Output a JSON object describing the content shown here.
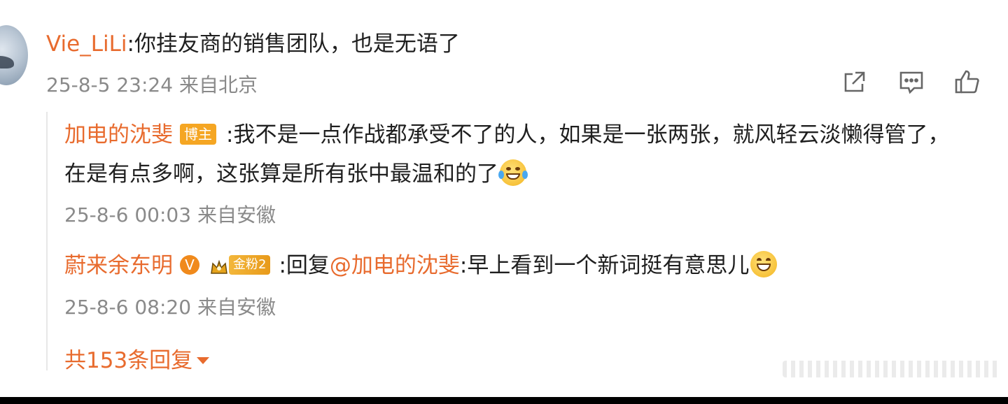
{
  "main_comment": {
    "username": "Vie_LiLi",
    "separator": ":",
    "text": "你挂友商的销售团队，也是无语了",
    "timestamp": "25-8-5 23:24",
    "location": "来自北京"
  },
  "actions": {
    "share_icon": "share-icon",
    "comment_icon": "comment-icon",
    "like_icon": "like-icon"
  },
  "replies": [
    {
      "username": "加电的沈斐",
      "badge": "博主",
      "separator": ":",
      "text_line1": "我不是一点作战都承受不了的人，如果是一张两张，就风轻云淡懒得管了，",
      "text_line2": "在是有点多啊，这张算是所有张中最温和的了",
      "timestamp": "25-8-6 00:03",
      "location": "来自安徽"
    },
    {
      "username": "蔚来余东明",
      "verified_mark": "V",
      "fan_badge": "金粉2",
      "separator": ":",
      "reply_prefix": "回复",
      "mention": "@加电的沈斐",
      "text_after": ":早上看到一个新词挺有意思儿",
      "timestamp": "25-8-6 08:20",
      "location": "来自安徽"
    }
  ],
  "more_replies_label": "共153条回复",
  "colors": {
    "username": "#e86b2e",
    "text": "#1f1f1f",
    "meta": "#8a8a8a",
    "blogger_badge": "#f5a623"
  }
}
